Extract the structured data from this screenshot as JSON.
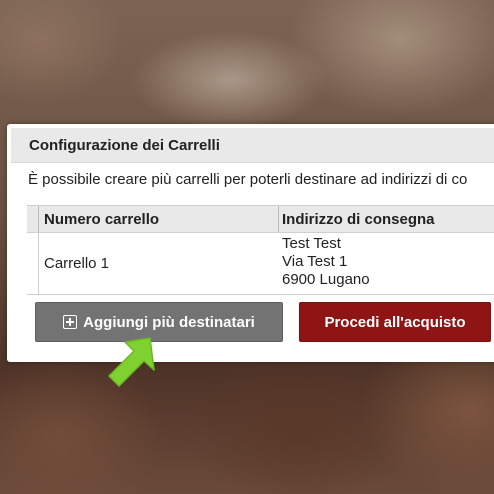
{
  "dialog": {
    "title": "Configurazione dei Carrelli",
    "description": "È possibile creare più carrelli per poterli destinare ad indirizzi di co",
    "table": {
      "headers": [
        "Numero carrello",
        "Indirizzo di consegna"
      ],
      "rows": [
        {
          "cart": "Carrello 1",
          "address_lines": [
            "Test Test",
            "Via Test 1",
            "6900 Lugano"
          ]
        }
      ]
    },
    "buttons": {
      "add_recipients": "Aggiungi più destinatari",
      "proceed": "Procedi all'acquisto"
    }
  },
  "icons": {
    "add": "plus-square-icon",
    "pointer": "green-arrow-icon"
  },
  "colors": {
    "proceed_button": "#8f1414",
    "add_button": "#737373",
    "arrow": "#7fd12f"
  }
}
